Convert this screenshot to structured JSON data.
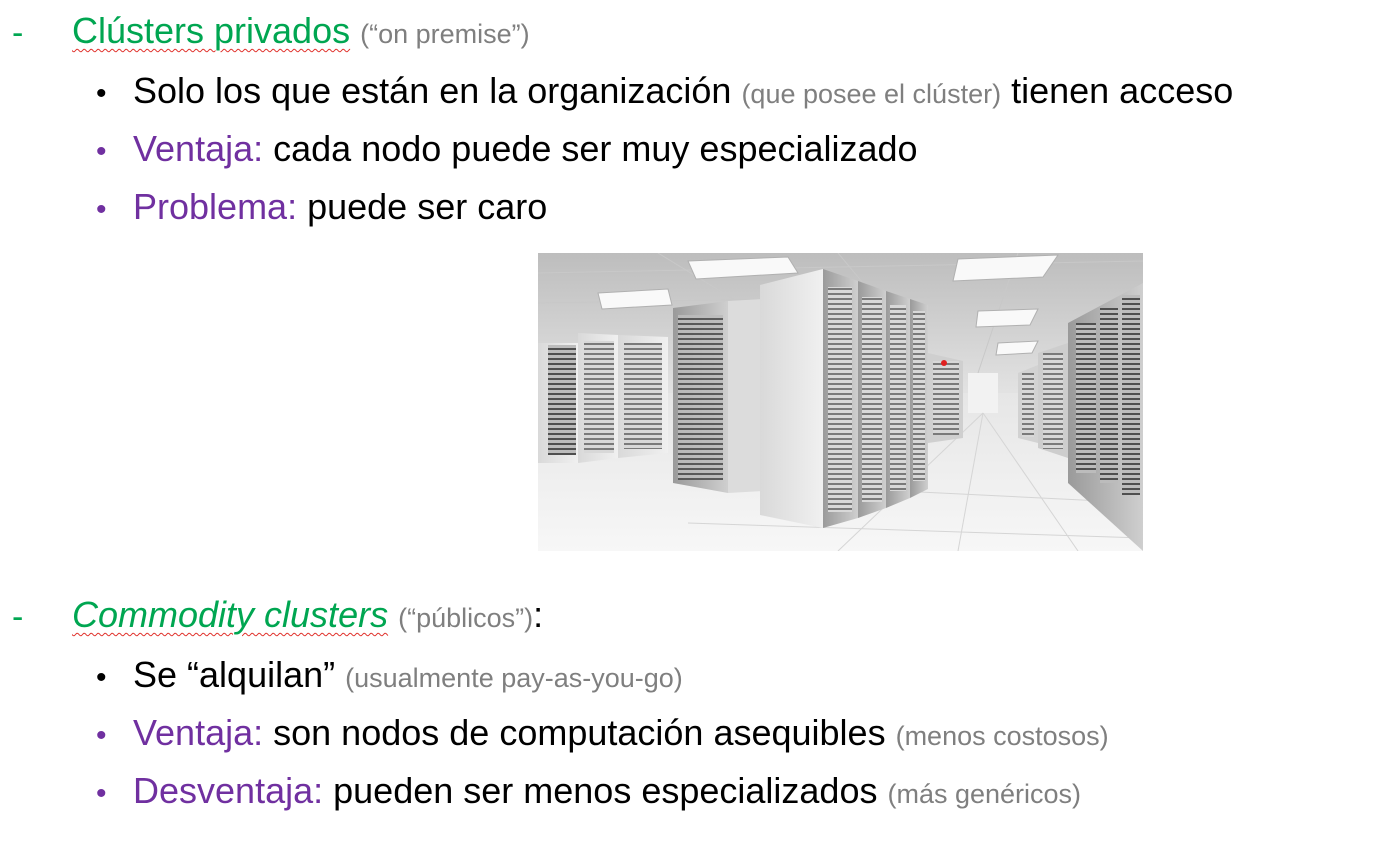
{
  "section1": {
    "dash": "-",
    "title": "Clústers privados",
    "title_note": "(“on premise”)",
    "items": [
      {
        "bullet": "•",
        "lead": "",
        "text": "Solo los que están en la organización",
        "note": "(que posee el clúster)",
        "tail": "tienen acceso"
      },
      {
        "bullet": "•",
        "lead": "Ventaja:",
        "text": "cada nodo puede ser muy especializado"
      },
      {
        "bullet": "•",
        "lead": "Problema:",
        "text": "puede ser caro"
      }
    ]
  },
  "image": {
    "description_icon": "server-room-photo"
  },
  "section2": {
    "dash": "-",
    "title": "Commodity clusters",
    "title_note": "(“públicos”)",
    "title_colon": ":",
    "items": [
      {
        "bullet": "•",
        "text": "Se “alquilan”",
        "note": "(usualmente pay-as-you-go)"
      },
      {
        "bullet": "•",
        "lead": "Ventaja:",
        "text": "son nodos de computación asequibles",
        "note": "(menos costosos)"
      },
      {
        "bullet": "•",
        "lead": "Desventaja:",
        "text": "pueden ser menos especializados",
        "note": "(más genéricos)"
      }
    ]
  },
  "colors": {
    "green": "#00a651",
    "purple": "#7030a0",
    "gray": "#7f7f7f"
  }
}
